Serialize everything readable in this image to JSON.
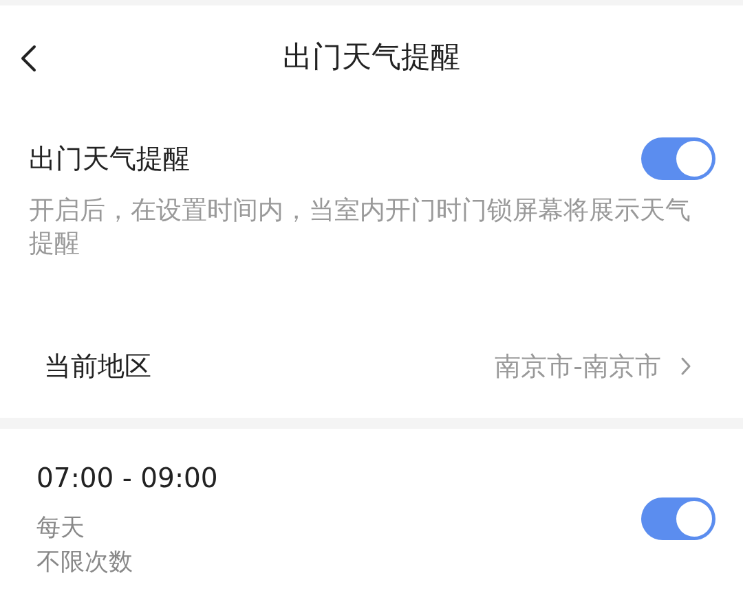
{
  "header": {
    "title": "出门天气提醒"
  },
  "reminder": {
    "label": "出门天气提醒",
    "on": true,
    "description": "开启后，在设置时间内，当室内开门时门锁屏幕将展示天气提醒"
  },
  "region": {
    "label": "当前地区",
    "value": "南京市-南京市"
  },
  "schedules": [
    {
      "time": "07:00 - 09:00",
      "repeat": "每天",
      "limit": "不限次数",
      "on": true
    }
  ]
}
